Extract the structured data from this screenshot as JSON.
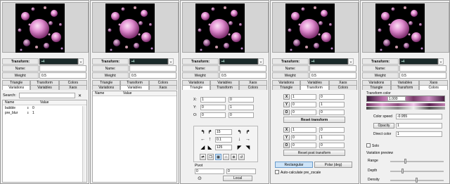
{
  "transform": {
    "label": "Transform:",
    "value": "4"
  },
  "name": {
    "label": "Name:",
    "value": ""
  },
  "weight": {
    "label": "Weight:",
    "value": "0.5"
  },
  "tabs_row1": [
    "Triangle",
    "Transform",
    "Colors"
  ],
  "tabs_row2": [
    "Variations",
    "Variables",
    "Xaos"
  ],
  "panel1": {
    "search_label": "Search:",
    "clear_icon": "✕",
    "columns": [
      "Name",
      "Value"
    ],
    "rows": [
      {
        "name": "bubble",
        "value": "0"
      },
      {
        "name": "pre_blur",
        "value": "1"
      }
    ]
  },
  "panel2": {
    "columns": [
      "Name",
      "Value"
    ]
  },
  "panel3": {
    "coords": [
      {
        "label": "X:",
        "a": "1",
        "b": "0"
      },
      {
        "label": "Y:",
        "a": "0",
        "b": "1"
      },
      {
        "label": "O:",
        "a": "0",
        "b": "0"
      }
    ],
    "rotate_value": "15",
    "move_value": "0.1",
    "scale_value": "125",
    "pivot_label": "Pivot",
    "pivot_x": "0",
    "pivot_y": "0",
    "pivot_button": "Local"
  },
  "panel4": {
    "rows": [
      {
        "label": "X",
        "a": "1",
        "b": "0"
      },
      {
        "label": "Y",
        "a": "0",
        "b": "1"
      },
      {
        "label": "O",
        "a": "0",
        "b": "0"
      }
    ],
    "reset_transform": "Reset transform",
    "post_rows": [
      {
        "label": "X",
        "a": "1",
        "b": "0"
      },
      {
        "label": "Y",
        "a": "0",
        "b": "1"
      },
      {
        "label": "O",
        "a": "0",
        "b": "0"
      }
    ],
    "reset_post": "Reset post transform",
    "rectangular": "Rectangular",
    "polar": "Polar (deg)",
    "auto_calc": "Auto-calculate pre_zscale"
  },
  "panel5": {
    "transform_color_label": "Transform color",
    "transform_color_value": "1.000",
    "color_speed_label": "Color speed",
    "color_speed_value": "-0.955",
    "opacity_label": "Opacity",
    "opacity_value": "1",
    "direct_color_label": "Direct color",
    "direct_color_value": "1",
    "solo_label": "Solo",
    "variation_preview_label": "Variation preview",
    "range_label": "Range",
    "depth_label": "Depth",
    "density_label": "Density"
  },
  "colors": {
    "combo_bg": "#1a2a2a",
    "selected": "#cde3f7",
    "fractal_bg": "#000000",
    "fractal_pink": "#d77cc4"
  }
}
